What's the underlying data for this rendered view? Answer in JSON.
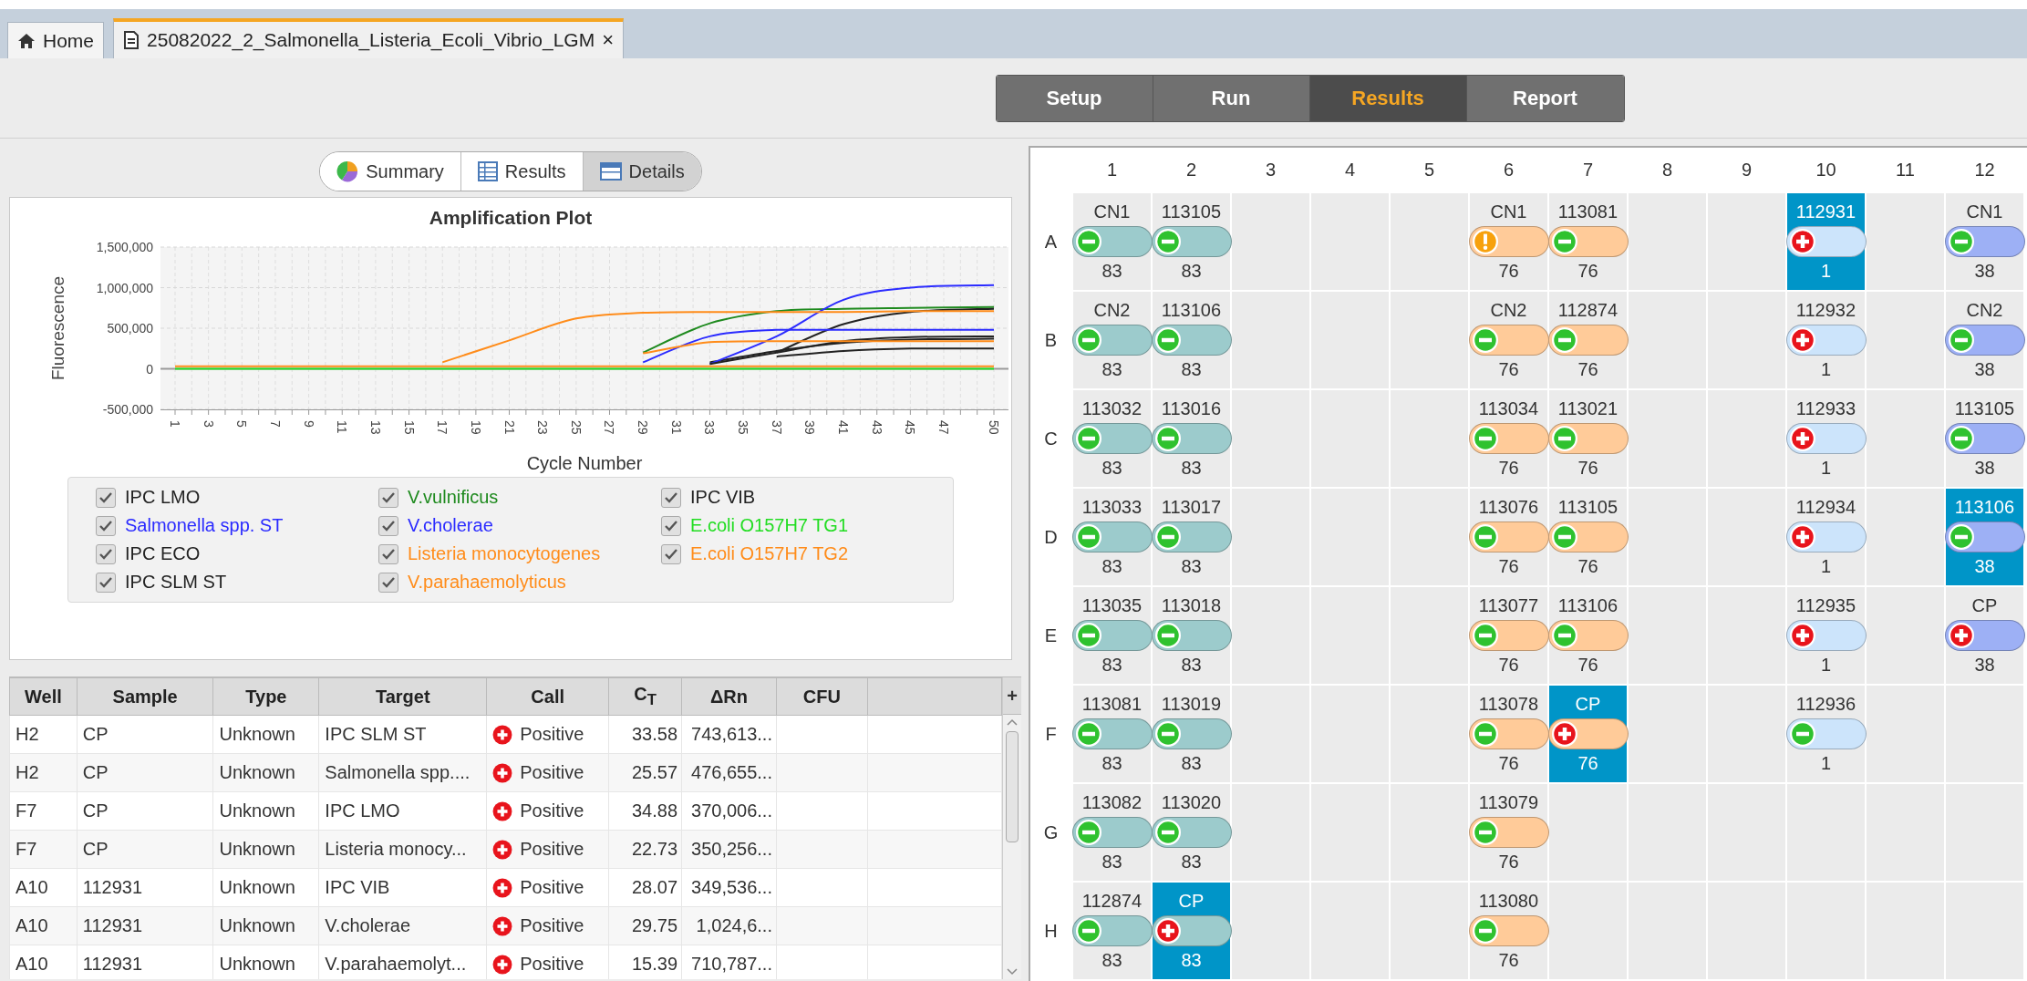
{
  "tabs": [
    {
      "label": "Home",
      "kind": "home",
      "selected": false
    },
    {
      "label": "25082022_2_Salmonella_Listeria_Ecoli_Vibrio_LGM",
      "kind": "document",
      "selected": true,
      "close": "×"
    }
  ],
  "steps": [
    {
      "label": "Setup",
      "selected": false
    },
    {
      "label": "Run",
      "selected": false
    },
    {
      "label": "Results",
      "selected": true
    },
    {
      "label": "Report",
      "selected": false
    }
  ],
  "views": [
    {
      "label": "Summary",
      "kind": "pie",
      "selected": false
    },
    {
      "label": "Results",
      "kind": "table",
      "selected": false
    },
    {
      "label": "Details",
      "kind": "panel",
      "selected": true
    }
  ],
  "chart": {
    "chart_data": {
      "type": "line",
      "title": "Amplification Plot",
      "xlabel": "Cycle Number",
      "ylabel": "Fluorescence",
      "grid": true,
      "x": [
        1,
        5,
        9,
        13,
        17,
        21,
        25,
        29,
        33,
        37,
        41,
        45,
        50
      ],
      "series": [
        {
          "name": "IPC LMO",
          "color": "#222222",
          "values": [
            null,
            null,
            null,
            null,
            null,
            null,
            null,
            null,
            80000,
            220000,
            320000,
            360000,
            370000
          ]
        },
        {
          "name": "V.vulnificus",
          "color": "#1e8a1e",
          "values": [
            null,
            null,
            null,
            null,
            null,
            null,
            null,
            200000,
            560000,
            710000,
            740000,
            750000,
            760000
          ]
        },
        {
          "name": "IPC VIB",
          "color": "#222222",
          "values": [
            null,
            null,
            null,
            null,
            null,
            null,
            null,
            null,
            null,
            200000,
            550000,
            700000,
            740000
          ]
        },
        {
          "name": "Salmonella spp. ST",
          "color": "#2b2bff",
          "values": [
            null,
            null,
            null,
            null,
            null,
            null,
            null,
            80000,
            400000,
            480000,
            480000,
            480000,
            480000
          ]
        },
        {
          "name": "V.cholerae",
          "color": "#2b2bff",
          "values": [
            null,
            null,
            null,
            null,
            null,
            null,
            null,
            null,
            60000,
            400000,
            850000,
            1000000,
            1030000
          ]
        },
        {
          "name": "E.coli O157H7 TG1",
          "color": "#22dd22",
          "values": [
            0,
            0,
            0,
            0,
            0,
            0,
            0,
            0,
            0,
            0,
            0,
            0,
            0
          ]
        },
        {
          "name": "IPC ECO",
          "color": "#222222",
          "values": [
            null,
            null,
            null,
            null,
            null,
            null,
            null,
            null,
            60000,
            200000,
            340000,
            390000,
            400000
          ]
        },
        {
          "name": "Listeria monocytogenes",
          "color": "#ff8c1a",
          "values": [
            null,
            null,
            null,
            null,
            80000,
            350000,
            620000,
            690000,
            700000,
            700000,
            700000,
            710000,
            710000
          ]
        },
        {
          "name": "E.coli O157H7 TG2",
          "color": "#ff8c1a",
          "values": [
            30000,
            30000,
            30000,
            30000,
            30000,
            30000,
            30000,
            30000,
            30000,
            30000,
            30000,
            30000,
            30000
          ]
        },
        {
          "name": "IPC SLM ST",
          "color": "#222222",
          "values": [
            null,
            null,
            null,
            null,
            null,
            null,
            null,
            null,
            null,
            150000,
            220000,
            250000,
            250000
          ]
        },
        {
          "name": "V.parahaemolyticus",
          "color": "#ff8c1a",
          "values": [
            null,
            null,
            null,
            null,
            null,
            null,
            null,
            190000,
            330000,
            340000,
            340000,
            340000,
            340000
          ]
        }
      ],
      "xlim": [
        1,
        50
      ],
      "ylim": [
        -500000,
        1500000
      ],
      "xticks": [
        1,
        3,
        5,
        7,
        9,
        11,
        13,
        15,
        17,
        19,
        21,
        23,
        25,
        27,
        29,
        31,
        33,
        35,
        37,
        39,
        41,
        43,
        45,
        47,
        50
      ],
      "yticks": [
        {
          "value": -500000,
          "label": "-500,000"
        },
        {
          "value": 0,
          "label": "0"
        },
        {
          "value": 500000,
          "label": "500,000"
        },
        {
          "value": 1000000,
          "label": "1,000,000"
        },
        {
          "value": 1500000,
          "label": "1,500,000"
        }
      ]
    },
    "legend": [
      {
        "checked": true
      },
      {
        "checked": true
      },
      {
        "checked": true
      },
      {
        "checked": true
      },
      {
        "checked": true
      },
      {
        "checked": true
      },
      {
        "checked": true
      },
      {
        "checked": true
      },
      {
        "checked": true
      },
      {
        "checked": true
      },
      {
        "checked": true
      }
    ]
  },
  "table": {
    "columns": [
      "Well",
      "Sample",
      "Type",
      "Target",
      "Call",
      "C$_{T}$",
      "ΔRn",
      "CFU"
    ],
    "add_column": "+",
    "rows": [
      {
        "well": "H2",
        "sample": "CP",
        "type": "Unknown",
        "target": "IPC SLM ST",
        "call": {
          "label": "Positive",
          "kind": "positive"
        },
        "ct": "33.58",
        "delta_rn": "743,613..."
      },
      {
        "well": "H2",
        "sample": "CP",
        "type": "Unknown",
        "target": "Salmonella spp....",
        "call": {
          "label": "Positive",
          "kind": "positive"
        },
        "ct": "25.57",
        "delta_rn": "476,655..."
      },
      {
        "well": "F7",
        "sample": "CP",
        "type": "Unknown",
        "target": "IPC LMO",
        "call": {
          "label": "Positive",
          "kind": "positive"
        },
        "ct": "34.88",
        "delta_rn": "370,006..."
      },
      {
        "well": "F7",
        "sample": "CP",
        "type": "Unknown",
        "target": "Listeria monocy...",
        "call": {
          "label": "Positive",
          "kind": "positive"
        },
        "ct": "22.73",
        "delta_rn": "350,256..."
      },
      {
        "well": "A10",
        "sample": "112931",
        "type": "Unknown",
        "target": "IPC VIB",
        "call": {
          "label": "Positive",
          "kind": "positive"
        },
        "ct": "28.07",
        "delta_rn": "349,536..."
      },
      {
        "well": "A10",
        "sample": "112931",
        "type": "Unknown",
        "target": "V.cholerae",
        "call": {
          "label": "Positive",
          "kind": "positive"
        },
        "ct": "29.75",
        "delta_rn": "1,024,6..."
      },
      {
        "well": "A10",
        "sample": "112931",
        "type": "Unknown",
        "target": "V.parahaemolyt...",
        "call": {
          "label": "Positive",
          "kind": "positive"
        },
        "ct": "15.39",
        "delta_rn": "710,787..."
      }
    ]
  },
  "plate": {
    "columns": [
      "1",
      "2",
      "3",
      "4",
      "5",
      "6",
      "7",
      "8",
      "9",
      "10",
      "11",
      "12"
    ],
    "rows": [
      {
        "label": "A",
        "cells": [
          {
            "sample": "CN1",
            "kind": "negative",
            "color": "#9ccbcc",
            "number": "83",
            "selected": false
          },
          {
            "sample": "113105",
            "kind": "negative",
            "color": "#9ccbcc",
            "number": "83",
            "selected": false
          },
          null,
          null,
          null,
          {
            "sample": "CN1",
            "kind": "warning",
            "color": "#ffcb99",
            "number": "76",
            "selected": false
          },
          {
            "sample": "113081",
            "kind": "negative",
            "color": "#ffcb99",
            "number": "76",
            "selected": false
          },
          null,
          null,
          {
            "sample": "112931",
            "kind": "positive",
            "color": "#cce4fb",
            "number": "1",
            "selected": true
          },
          null,
          {
            "sample": "CN1",
            "kind": "negative",
            "color": "#9db0f5",
            "number": "38",
            "selected": false
          }
        ]
      },
      {
        "label": "B",
        "cells": [
          {
            "sample": "CN2",
            "kind": "negative",
            "color": "#9ccbcc",
            "number": "83",
            "selected": false
          },
          {
            "sample": "113106",
            "kind": "negative",
            "color": "#9ccbcc",
            "number": "83",
            "selected": false
          },
          null,
          null,
          null,
          {
            "sample": "CN2",
            "kind": "negative",
            "color": "#ffcb99",
            "number": "76",
            "selected": false
          },
          {
            "sample": "112874",
            "kind": "negative",
            "color": "#ffcb99",
            "number": "76",
            "selected": false
          },
          null,
          null,
          {
            "sample": "112932",
            "kind": "positive",
            "color": "#cce4fb",
            "number": "1",
            "selected": false
          },
          null,
          {
            "sample": "CN2",
            "kind": "negative",
            "color": "#9db0f5",
            "number": "38",
            "selected": false
          }
        ]
      },
      {
        "label": "C",
        "cells": [
          {
            "sample": "113032",
            "kind": "negative",
            "color": "#9ccbcc",
            "number": "83",
            "selected": false
          },
          {
            "sample": "113016",
            "kind": "negative",
            "color": "#9ccbcc",
            "number": "83",
            "selected": false
          },
          null,
          null,
          null,
          {
            "sample": "113034",
            "kind": "negative",
            "color": "#ffcb99",
            "number": "76",
            "selected": false
          },
          {
            "sample": "113021",
            "kind": "negative",
            "color": "#ffcb99",
            "number": "76",
            "selected": false
          },
          null,
          null,
          {
            "sample": "112933",
            "kind": "positive",
            "color": "#cce4fb",
            "number": "1",
            "selected": false
          },
          null,
          {
            "sample": "113105",
            "kind": "negative",
            "color": "#9db0f5",
            "number": "38",
            "selected": false
          }
        ]
      },
      {
        "label": "D",
        "cells": [
          {
            "sample": "113033",
            "kind": "negative",
            "color": "#9ccbcc",
            "number": "83",
            "selected": false
          },
          {
            "sample": "113017",
            "kind": "negative",
            "color": "#9ccbcc",
            "number": "83",
            "selected": false
          },
          null,
          null,
          null,
          {
            "sample": "113076",
            "kind": "negative",
            "color": "#ffcb99",
            "number": "76",
            "selected": false
          },
          {
            "sample": "113105",
            "kind": "negative",
            "color": "#ffcb99",
            "number": "76",
            "selected": false
          },
          null,
          null,
          {
            "sample": "112934",
            "kind": "positive",
            "color": "#cce4fb",
            "number": "1",
            "selected": false
          },
          null,
          {
            "sample": "113106",
            "kind": "negative",
            "color": "#9db0f5",
            "number": "38",
            "selected": true
          }
        ]
      },
      {
        "label": "E",
        "cells": [
          {
            "sample": "113035",
            "kind": "negative",
            "color": "#9ccbcc",
            "number": "83",
            "selected": false
          },
          {
            "sample": "113018",
            "kind": "negative",
            "color": "#9ccbcc",
            "number": "83",
            "selected": false
          },
          null,
          null,
          null,
          {
            "sample": "113077",
            "kind": "negative",
            "color": "#ffcb99",
            "number": "76",
            "selected": false
          },
          {
            "sample": "113106",
            "kind": "negative",
            "color": "#ffcb99",
            "number": "76",
            "selected": false
          },
          null,
          null,
          {
            "sample": "112935",
            "kind": "positive",
            "color": "#cce4fb",
            "number": "1",
            "selected": false
          },
          null,
          {
            "sample": "CP",
            "kind": "positive",
            "color": "#9db0f5",
            "number": "38",
            "selected": false
          }
        ]
      },
      {
        "label": "F",
        "cells": [
          {
            "sample": "113081",
            "kind": "negative",
            "color": "#9ccbcc",
            "number": "83",
            "selected": false
          },
          {
            "sample": "113019",
            "kind": "negative",
            "color": "#9ccbcc",
            "number": "83",
            "selected": false
          },
          null,
          null,
          null,
          {
            "sample": "113078",
            "kind": "negative",
            "color": "#ffcb99",
            "number": "76",
            "selected": false
          },
          {
            "sample": "CP",
            "kind": "positive",
            "color": "#ffcb99",
            "number": "76",
            "selected": true
          },
          null,
          null,
          {
            "sample": "112936",
            "kind": "negative",
            "color": "#cce4fb",
            "number": "1",
            "selected": false
          },
          null,
          null
        ]
      },
      {
        "label": "G",
        "cells": [
          {
            "sample": "113082",
            "kind": "negative",
            "color": "#9ccbcc",
            "number": "83",
            "selected": false
          },
          {
            "sample": "113020",
            "kind": "negative",
            "color": "#9ccbcc",
            "number": "83",
            "selected": false
          },
          null,
          null,
          null,
          {
            "sample": "113079",
            "kind": "negative",
            "color": "#ffcb99",
            "number": "76",
            "selected": false
          },
          null,
          null,
          null,
          null,
          null,
          null
        ]
      },
      {
        "label": "H",
        "cells": [
          {
            "sample": "112874",
            "kind": "negative",
            "color": "#9ccbcc",
            "number": "83",
            "selected": false
          },
          {
            "sample": "CP",
            "kind": "positive",
            "color": "#9ccbcc",
            "number": "83",
            "selected": true
          },
          null,
          null,
          null,
          {
            "sample": "113080",
            "kind": "negative",
            "color": "#ffcb99",
            "number": "76",
            "selected": false
          },
          null,
          null,
          null,
          null,
          null,
          null
        ]
      }
    ]
  }
}
